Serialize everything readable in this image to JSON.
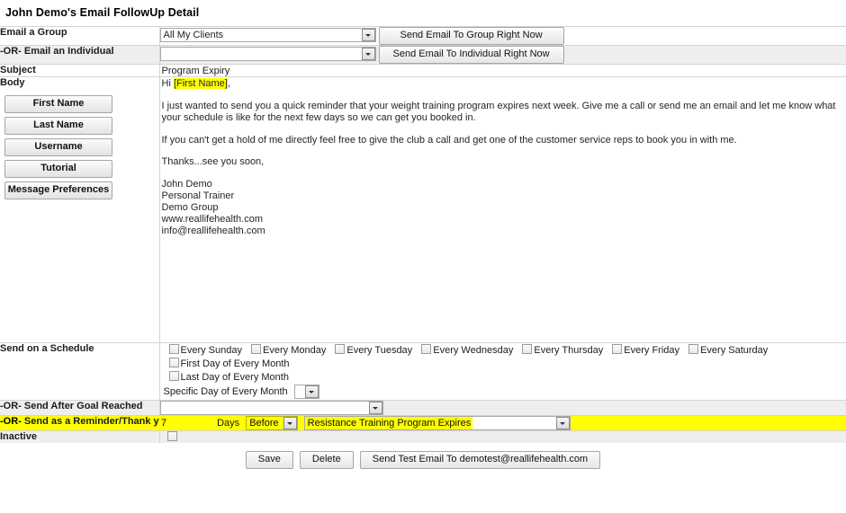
{
  "page": {
    "title": "John Demo's Email FollowUp Detail"
  },
  "rows": {
    "email_group": {
      "label": "Email a Group",
      "select_value": "All My Clients",
      "button": "Send Email To Group Right Now"
    },
    "email_individual": {
      "label": "-OR- Email an Individual",
      "select_value": "",
      "button": "Send Email To Individual Right Now"
    },
    "subject": {
      "label": "Subject",
      "value": "Program Expiry"
    },
    "body": {
      "label": "Body",
      "tokens": [
        "First Name",
        "Last Name",
        "Username",
        "Tutorial",
        "Message Preferences"
      ],
      "greeting_prefix": "Hi ",
      "greeting_token": "[First Name]",
      "greeting_suffix": ",",
      "paragraph_1": "I just wanted to send you a quick reminder that your weight training program expires next week.  Give me a call or send me an email and let me know what your schedule is like for the next few days so we can get you booked in.",
      "paragraph_2": "If you can't get a hold of me directly feel free to give the club a call and get one of the customer service reps  to book you in with me.",
      "paragraph_3": "Thanks...see you soon,",
      "signature": [
        "John Demo",
        "Personal Trainer",
        "Demo Group",
        "www.reallifehealth.com",
        "info@reallifehealth.com"
      ]
    },
    "schedule": {
      "label": "Send on a Schedule",
      "weekdays": [
        "Every Sunday",
        "Every Monday",
        "Every Tuesday",
        "Every Wednesday",
        "Every Thursday",
        "Every Friday",
        "Every Saturday"
      ],
      "first_day": "First Day of Every Month",
      "last_day": "Last Day of Every Month",
      "specific_day_label": "Specific Day of Every Month",
      "specific_day_value": ""
    },
    "goal": {
      "label": "-OR- Send After Goal Reached",
      "select_value": ""
    },
    "reminder": {
      "label_or": "-OR-",
      "label": "Send as a Reminder/Thank you",
      "days_value": "7",
      "days_word": "Days",
      "before_after": "Before",
      "event_value": "Resistance Training Program Expires"
    },
    "inactive": {
      "label": "Inactive",
      "checked": false
    }
  },
  "footer": {
    "save": "Save",
    "delete": "Delete",
    "send_test": "Send Test Email To demotest@reallifehealth.com"
  },
  "colors": {
    "highlight": "#ffff00",
    "row_shade": "#eeeeee",
    "border": "#d4d4d4"
  }
}
